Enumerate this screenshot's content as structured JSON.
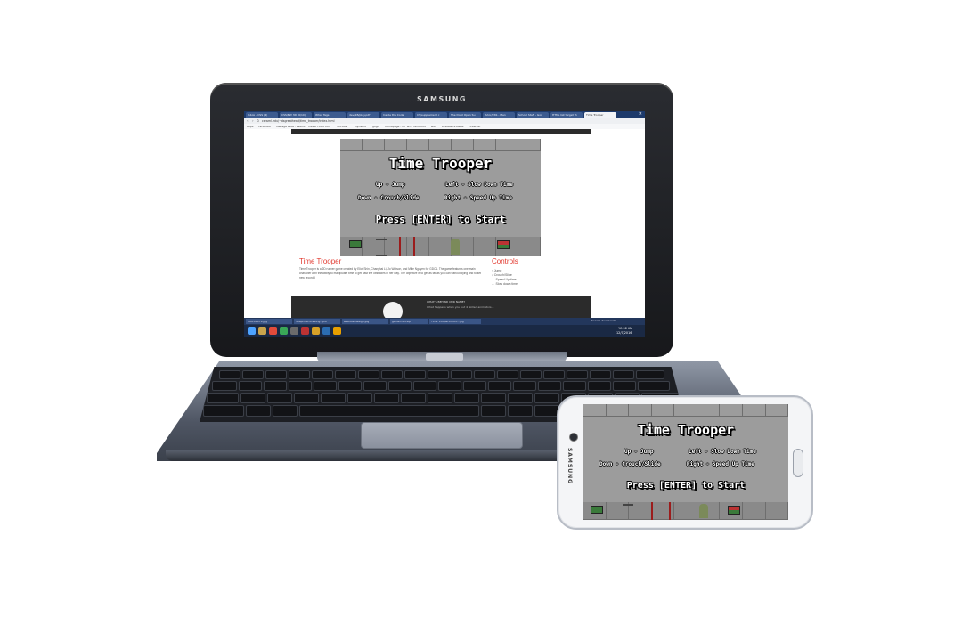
{
  "laptop": {
    "brand": "SAMSUNG",
    "browser": {
      "tabs": [
        {
          "label": "Inbox - CSS (4)"
        },
        {
          "label": "CSS/EW 3D (6/10)"
        },
        {
          "label": "What Tags"
        },
        {
          "label": "dev/1B/play.pdf"
        },
        {
          "label": "Inside the Code"
        },
        {
          "label": "CS/supplement c"
        },
        {
          "label": "The Dont Open Su"
        },
        {
          "label": "Tutor/CSS - Man"
        },
        {
          "label": "School Staff - Goo"
        },
        {
          "label": "HTML list target th"
        },
        {
          "label": "Time Trooper"
        }
      ],
      "address": "cs.wml.edu/~dsgreathead/time_trooper/index.html",
      "bookmarks": [
        "Apps",
        "Facebook",
        "Manage Beta - Rezolv",
        "Invest Fides com",
        "YouTube",
        "MyOsiris",
        "gogo",
        "Homepage - MY acc",
        "raincloud",
        "wiki",
        "DrexelethrAlerts",
        "Pinterest"
      ]
    },
    "game": {
      "title": "Time Trooper",
      "controls": [
        [
          "Up - Jump",
          "Left - Slow Down Time"
        ],
        [
          "Down - Crouch/Slide",
          "Right - Speed Up Time"
        ]
      ],
      "start_prompt": "Press [ENTER] to Start"
    },
    "webpage": {
      "heading": "Time Trooper",
      "description": "Time Trooper is a 2D runner game created by Eliot Shin, Changhai Li, Jo Watson, and Mike Nguyen for GDC1. The game features one main character with the ability to manipulate time to get past the obstacles in her way. The objective is to get as far as you can without dying and to set new records!",
      "controls_heading": "Controls",
      "controls": [
        "↑ Jump",
        "↓ Crouch/Slide",
        "→ Speed Up time",
        "← Slow down time"
      ],
      "team_heading": "WHAT'S BEHIND OUR NAME?",
      "team_text": "What happens when you put 4 skilled animators..."
    },
    "taskbar": {
      "items": [
        "IMG-0107S.jpg",
        "Snapchat-drawing...pdf",
        "website-design.jpg",
        "game.mov.zip",
        "Time Trooper-Portfo...jpg"
      ],
      "clock": "10:58 AM",
      "date": "12/7/2016",
      "search_label": "Search downloads..."
    }
  },
  "phone": {
    "brand": "SAMSUNG",
    "game": {
      "title": "Time Trooper",
      "controls": [
        [
          "Up - Jump",
          "Left - Slow Down Time"
        ],
        [
          "Down - Crouch/Slide",
          "Right - Speed Up Time"
        ]
      ],
      "start_prompt": "Press [ENTER] to Start"
    }
  }
}
